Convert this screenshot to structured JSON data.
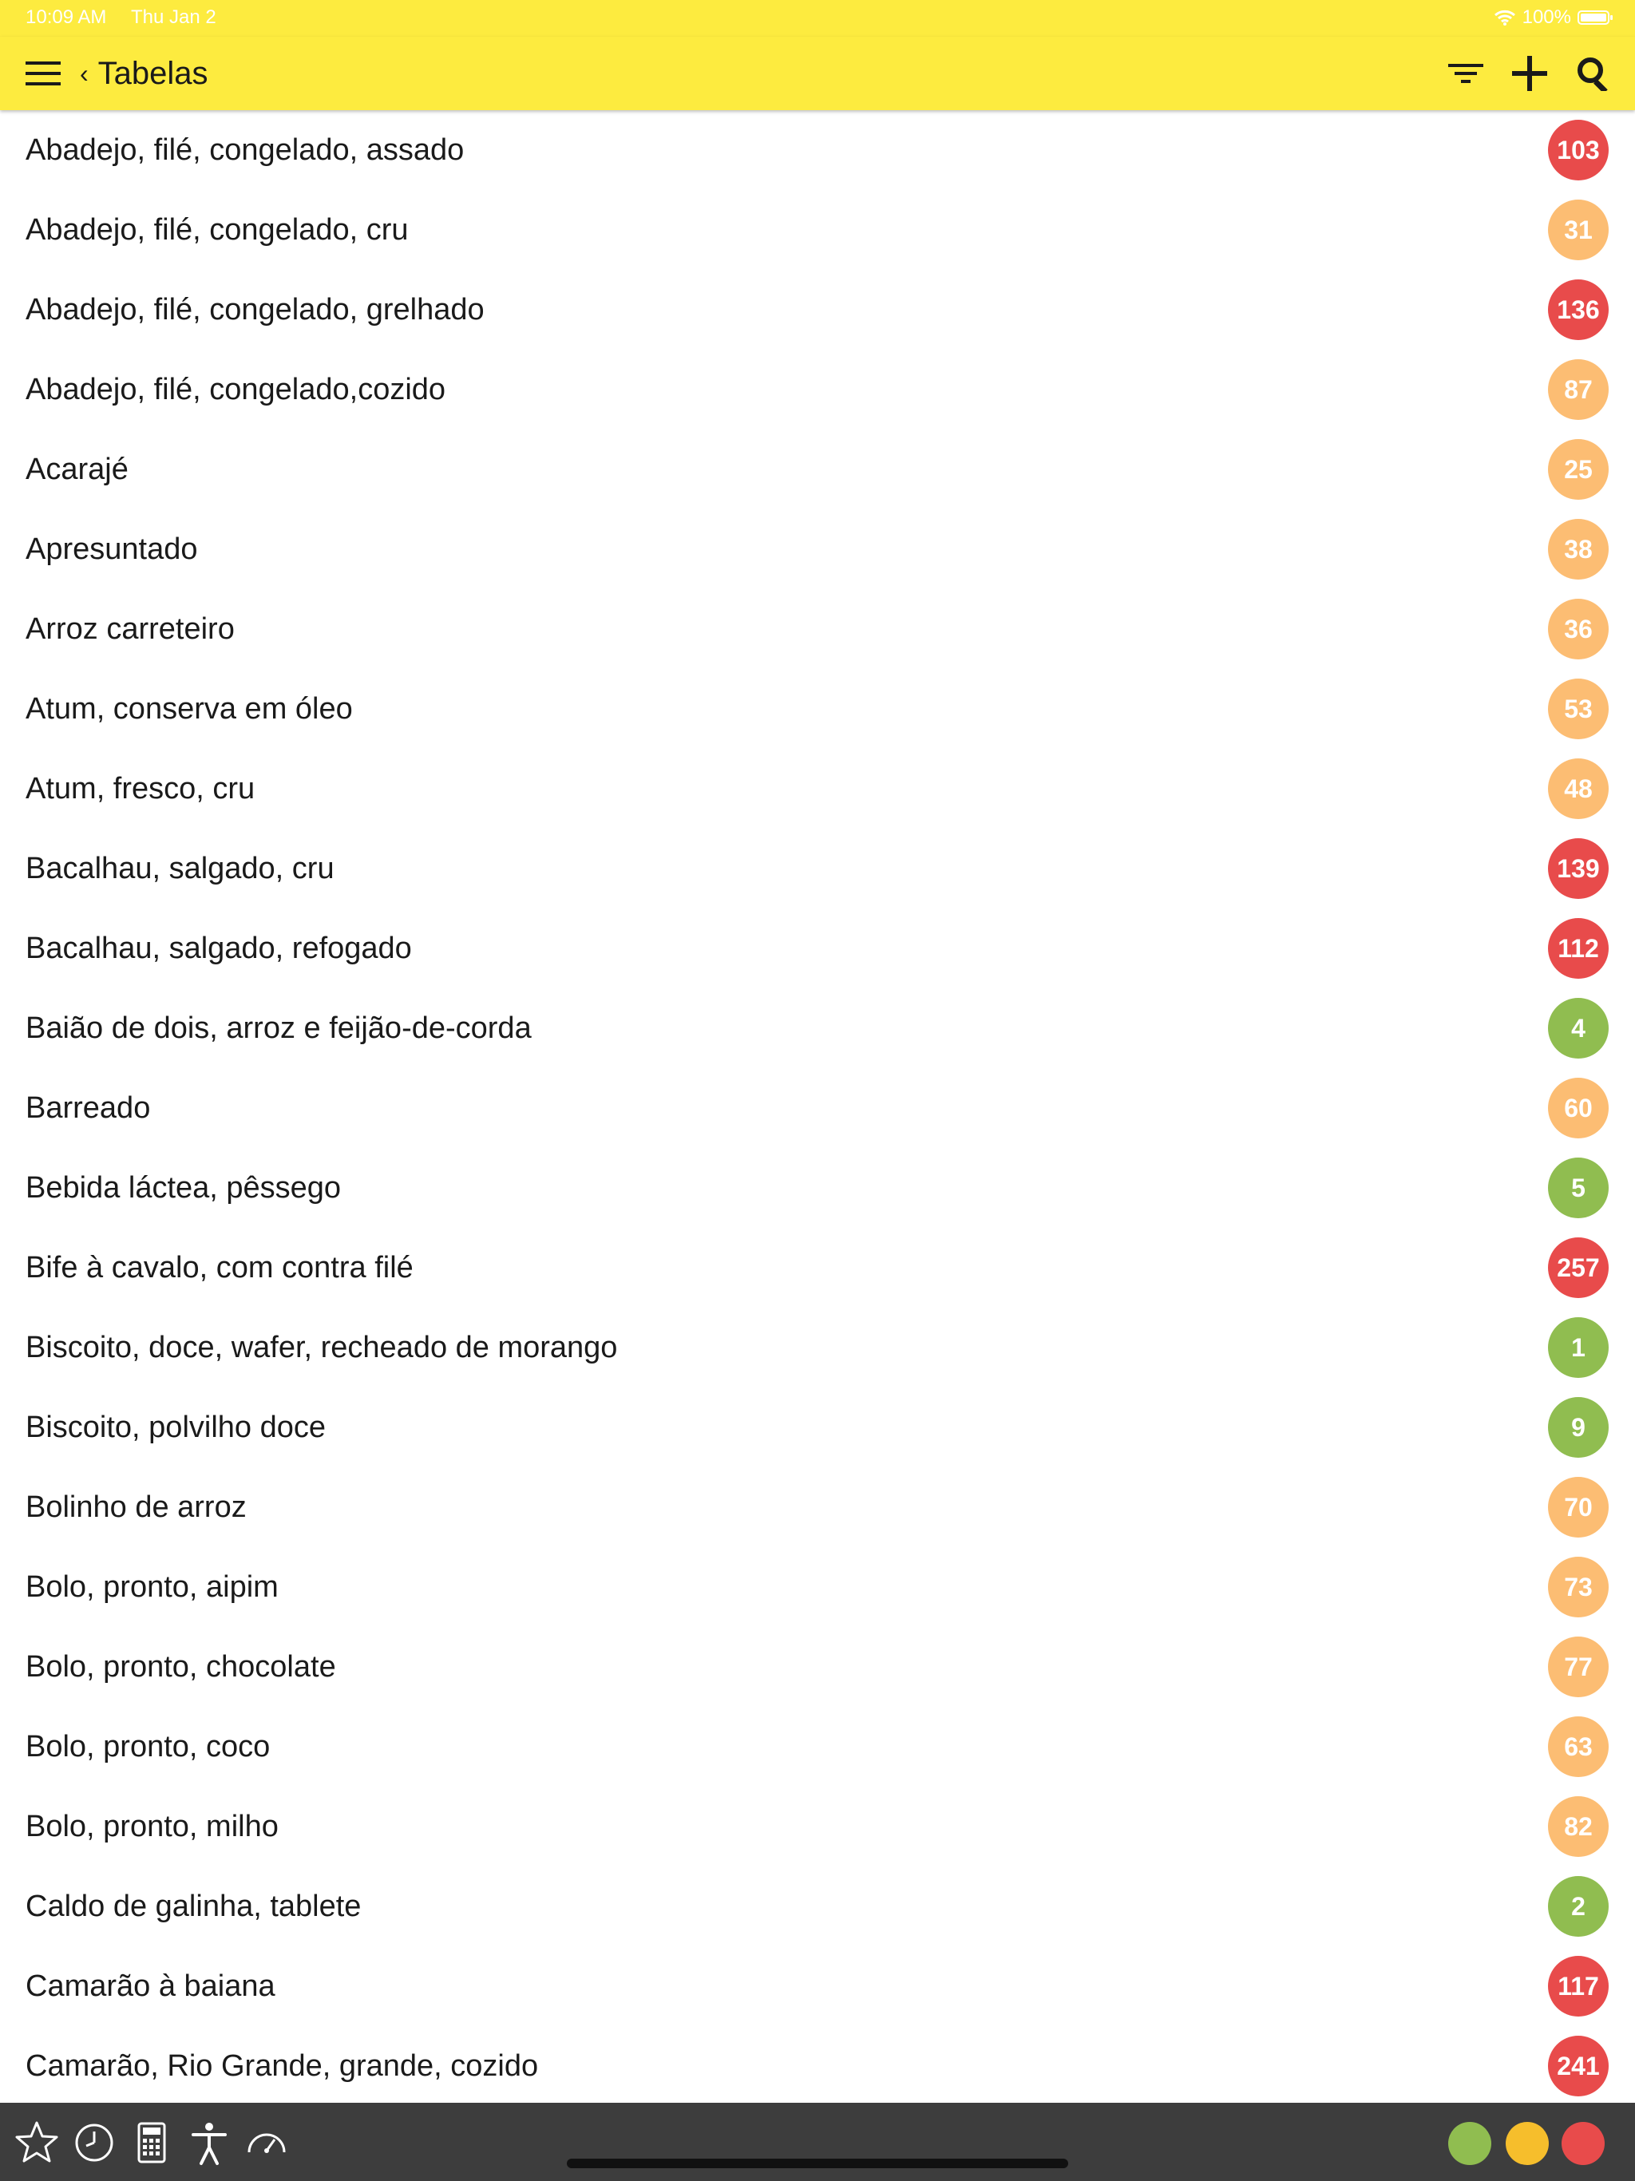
{
  "status_bar": {
    "time": "10:09 AM",
    "date": "Thu Jan 2",
    "battery": "100%"
  },
  "nav": {
    "back_label": "Tabelas"
  },
  "colors": {
    "nav_bg": "#fdeb3f",
    "red": "#e84b4b",
    "orange": "#fcbd73",
    "green": "#90bd50",
    "toolbar_bg": "#3d3d3d"
  },
  "items": [
    {
      "label": "Abadejo, filé, congelado, assado",
      "value": "103",
      "level": "red"
    },
    {
      "label": "Abadejo, filé, congelado, cru",
      "value": "31",
      "level": "orange"
    },
    {
      "label": "Abadejo, filé, congelado, grelhado",
      "value": "136",
      "level": "red"
    },
    {
      "label": "Abadejo, filé, congelado,cozido",
      "value": "87",
      "level": "orange"
    },
    {
      "label": "Acarajé",
      "value": "25",
      "level": "orange"
    },
    {
      "label": "Apresuntado",
      "value": "38",
      "level": "orange"
    },
    {
      "label": "Arroz carreteiro",
      "value": "36",
      "level": "orange"
    },
    {
      "label": "Atum, conserva em óleo",
      "value": "53",
      "level": "orange"
    },
    {
      "label": "Atum, fresco, cru",
      "value": "48",
      "level": "orange"
    },
    {
      "label": "Bacalhau, salgado, cru",
      "value": "139",
      "level": "red"
    },
    {
      "label": "Bacalhau, salgado, refogado",
      "value": "112",
      "level": "red"
    },
    {
      "label": "Baião de dois, arroz e feijão-de-corda",
      "value": "4",
      "level": "green"
    },
    {
      "label": "Barreado",
      "value": "60",
      "level": "orange"
    },
    {
      "label": "Bebida láctea, pêssego",
      "value": "5",
      "level": "green"
    },
    {
      "label": "Bife à cavalo, com contra filé",
      "value": "257",
      "level": "red"
    },
    {
      "label": "Biscoito, doce, wafer, recheado de morango",
      "value": "1",
      "level": "green"
    },
    {
      "label": "Biscoito, polvilho doce",
      "value": "9",
      "level": "green"
    },
    {
      "label": "Bolinho de arroz",
      "value": "70",
      "level": "orange"
    },
    {
      "label": "Bolo, pronto, aipim",
      "value": "73",
      "level": "orange"
    },
    {
      "label": "Bolo, pronto, chocolate",
      "value": "77",
      "level": "orange"
    },
    {
      "label": "Bolo, pronto, coco",
      "value": "63",
      "level": "orange"
    },
    {
      "label": "Bolo, pronto, milho",
      "value": "82",
      "level": "orange"
    },
    {
      "label": "Caldo de galinha, tablete",
      "value": "2",
      "level": "green"
    },
    {
      "label": "Camarão à baiana",
      "value": "117",
      "level": "red"
    },
    {
      "label": "Camarão, Rio Grande, grande, cozido",
      "value": "241",
      "level": "red"
    }
  ],
  "toolbar": {
    "tools": [
      "star-icon",
      "clock-icon",
      "calculator-icon",
      "person-icon",
      "gauge-icon"
    ],
    "level_dots": [
      "green",
      "orange",
      "red"
    ]
  }
}
